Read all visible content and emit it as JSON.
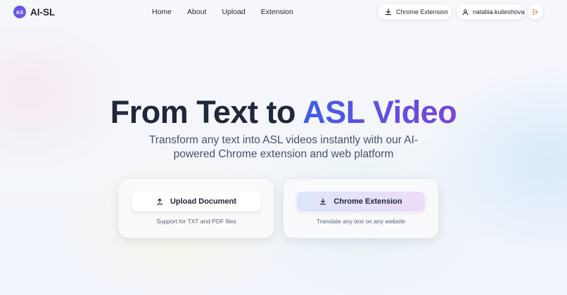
{
  "header": {
    "logo_badge": "AS",
    "logo_text": "AI-SL",
    "nav": [
      "Home",
      "About",
      "Upload",
      "Extension"
    ],
    "extension_button": "Chrome Extension",
    "username": "nataliia.kulieshova"
  },
  "hero": {
    "title_plain": "From Text to ",
    "title_accent": "ASL Video",
    "subtitle": "Transform any text into ASL videos instantly with our AI-powered Chrome extension and web platform"
  },
  "cards": {
    "upload": {
      "button": "Upload Document",
      "note": "Support for TXT and PDF files"
    },
    "extension": {
      "button": "Chrome Extension",
      "note": "Translate any text on any website"
    }
  },
  "colors": {
    "accent_start": "#3f5ee6",
    "accent_end": "#7b45da",
    "logout_icon": "#e08a4a"
  }
}
